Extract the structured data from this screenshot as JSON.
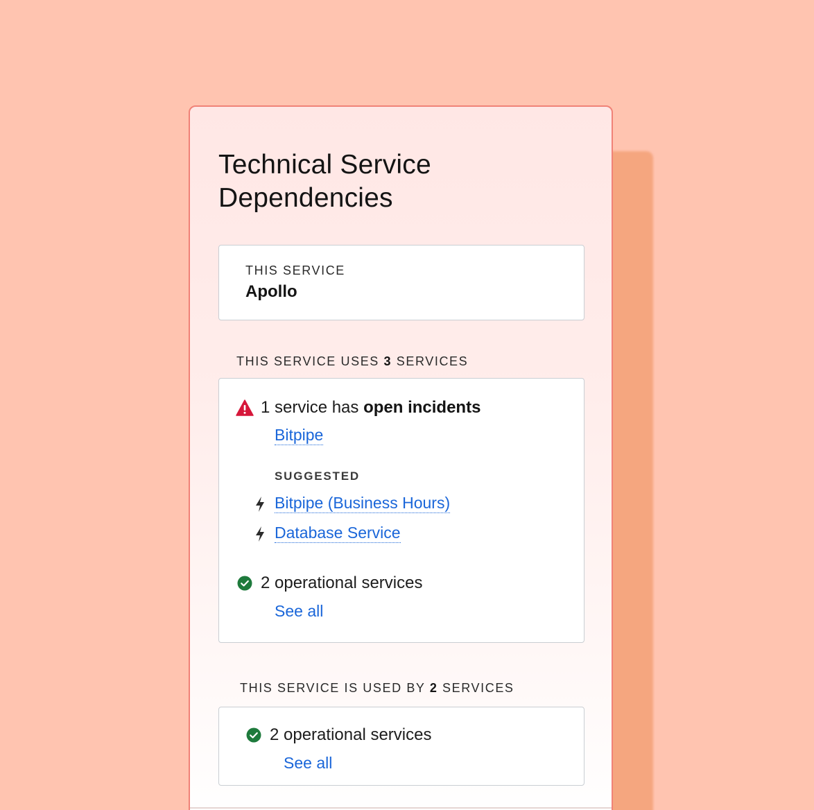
{
  "panel": {
    "title": "Technical Service Dependencies"
  },
  "this_service": {
    "label": "THIS SERVICE",
    "name": "Apollo"
  },
  "uses_section": {
    "prefix": "THIS SERVICE USES ",
    "count": "3",
    "suffix": " SERVICES",
    "incidents": {
      "icon": "warning-triangle-icon",
      "icon_color": "#D6173A",
      "text_prefix": "1 service has ",
      "text_bold": "open incidents",
      "links": [
        "Bitpipe"
      ]
    },
    "suggested": {
      "label": "SUGGESTED",
      "items": [
        {
          "icon": "lightning-bolt-icon",
          "label": "Bitpipe (Business Hours)"
        },
        {
          "icon": "lightning-bolt-icon",
          "label": "Database Service"
        }
      ]
    },
    "operational": {
      "icon": "check-circle-icon",
      "icon_color": "#1E7A3C",
      "text": "2 operational services",
      "see_all": "See all"
    }
  },
  "used_by_section": {
    "prefix": "THIS SERVICE IS USED BY ",
    "count": "2",
    "suffix": " SERVICES",
    "operational": {
      "icon": "check-circle-icon",
      "icon_color": "#1E7A3C",
      "text": "2 operational services",
      "see_all": "See all"
    }
  },
  "colors": {
    "background": "#FFC4B0",
    "panel_border": "#F08277",
    "link": "#1A66D9"
  }
}
